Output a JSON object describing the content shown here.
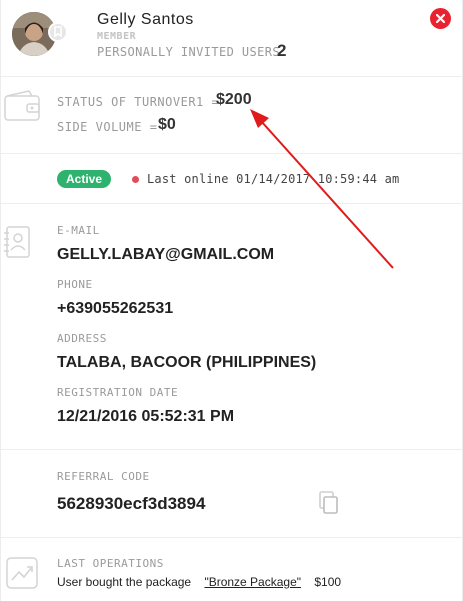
{
  "profile": {
    "name": "Gelly Santos",
    "role": "MEMBER",
    "invited_label": "PERSONALLY INVITED USERS",
    "invited_count": "2"
  },
  "turnover": {
    "status_label": "STATUS OF TURNOVER1 =",
    "status_value": "$200",
    "side_label": "SIDE VOLUME =",
    "side_value": "$0"
  },
  "status": {
    "badge": "Active",
    "last_online": "Last online 01/14/2017 10:59:44 am"
  },
  "contact": {
    "email_label": "E-MAIL",
    "email": "GELLY.LABAY@GMAIL.COM",
    "phone_label": "PHONE",
    "phone": "+639055262531",
    "address_label": "ADDRESS",
    "address": "TALABA, BACOOR (PHILIPPINES)",
    "reg_label": "REGISTRATION DATE",
    "reg_date": "12/21/2016 05:52:31 PM"
  },
  "referral": {
    "label": "REFERRAL CODE",
    "code": "5628930ecf3d3894"
  },
  "operations": {
    "label": "LAST OPERATIONS",
    "text_prefix": "User bought the package",
    "package_link": "\"Bronze Package\"",
    "amount": "$100"
  },
  "colors": {
    "active": "#2db36e",
    "close": "#e8232f",
    "offline_dot": "#e34b57",
    "annotation_arrow": "#e01b1b"
  },
  "icons": [
    "tag-icon",
    "close-icon",
    "wallet-icon",
    "contact-book-icon",
    "copy-icon",
    "chart-trend-icon"
  ]
}
